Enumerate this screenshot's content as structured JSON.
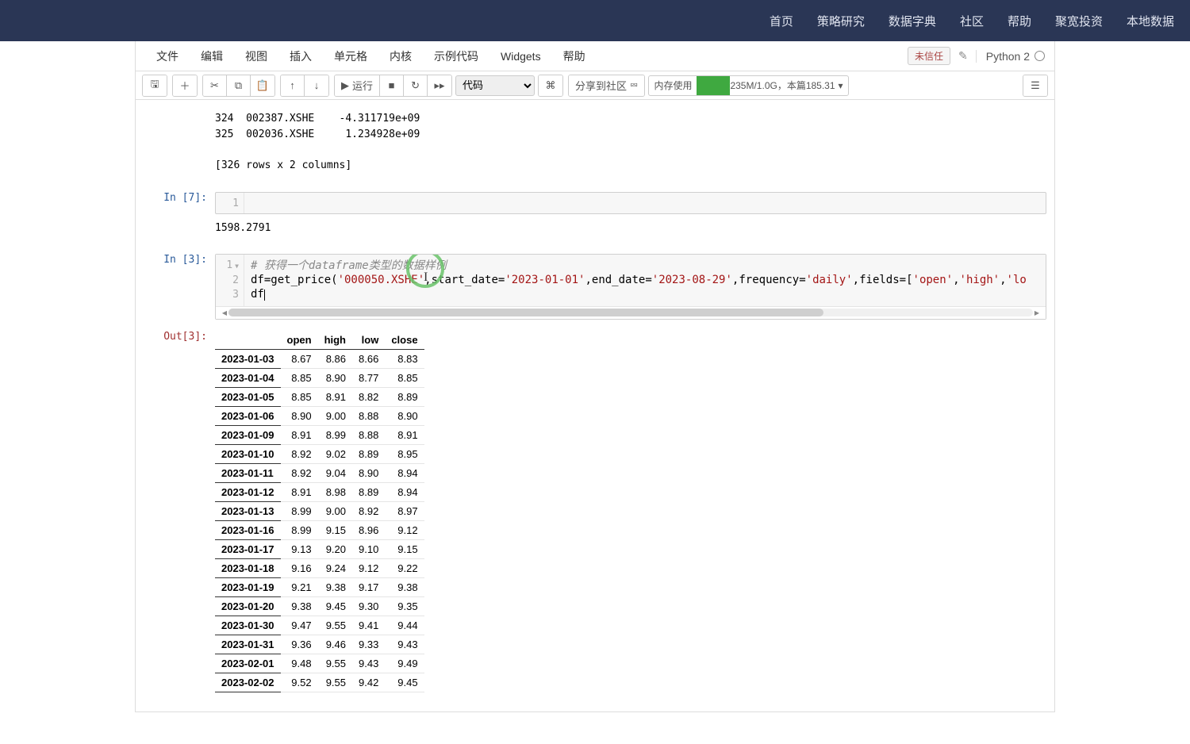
{
  "top_nav": {
    "items": [
      "首页",
      "策略研究",
      "数据字典",
      "社区",
      "帮助",
      "聚宽投资",
      "本地数据"
    ]
  },
  "menubar": {
    "items": [
      "文件",
      "编辑",
      "视图",
      "插入",
      "单元格",
      "内核",
      "示例代码",
      "Widgets",
      "帮助"
    ],
    "trust_badge": "未信任",
    "kernel": "Python 2"
  },
  "toolbar": {
    "run_label": "运行",
    "cell_type": "代码",
    "share_label": "分享到社区",
    "memory": {
      "label": "内存使用",
      "text": "235M/1.0G，本篇185.31"
    }
  },
  "cells": [
    {
      "type": "output",
      "text": "324  002387.XSHE    -4.311719e+09\n325  002036.XSHE     1.234928e+09\n\n[326 rows x 2 columns]"
    },
    {
      "type": "code",
      "prompt": "In  [7]:",
      "gutter": "1"
    },
    {
      "type": "output",
      "text": "1598.2791"
    },
    {
      "type": "code_main",
      "prompt": "In  [3]:",
      "gutters": [
        "1",
        "2",
        "3"
      ],
      "line1_comment": "# 获得一个dataframe类型的数据样例",
      "line2_a": "df=get_price(",
      "line2_s1": "'000050.XSHE'",
      "line2_b": ",start_date=",
      "line2_s2": "'2023-01-01'",
      "line2_c": ",end_date=",
      "line2_s3": "'2023-08-29'",
      "line2_d": ",frequency=",
      "line2_s4": "'daily'",
      "line2_e": ",fields=[",
      "line2_s5": "'open'",
      "line2_f": ",",
      "line2_s6": "'high'",
      "line2_g": ",",
      "line2_s7": "'lo",
      "line3": "df"
    },
    {
      "type": "df_output",
      "prompt": "Out[3]:",
      "columns": [
        "",
        "open",
        "high",
        "low",
        "close"
      ],
      "rows": [
        [
          "2023-01-03",
          "8.67",
          "8.86",
          "8.66",
          "8.83"
        ],
        [
          "2023-01-04",
          "8.85",
          "8.90",
          "8.77",
          "8.85"
        ],
        [
          "2023-01-05",
          "8.85",
          "8.91",
          "8.82",
          "8.89"
        ],
        [
          "2023-01-06",
          "8.90",
          "9.00",
          "8.88",
          "8.90"
        ],
        [
          "2023-01-09",
          "8.91",
          "8.99",
          "8.88",
          "8.91"
        ],
        [
          "2023-01-10",
          "8.92",
          "9.02",
          "8.89",
          "8.95"
        ],
        [
          "2023-01-11",
          "8.92",
          "9.04",
          "8.90",
          "8.94"
        ],
        [
          "2023-01-12",
          "8.91",
          "8.98",
          "8.89",
          "8.94"
        ],
        [
          "2023-01-13",
          "8.99",
          "9.00",
          "8.92",
          "8.97"
        ],
        [
          "2023-01-16",
          "8.99",
          "9.15",
          "8.96",
          "9.12"
        ],
        [
          "2023-01-17",
          "9.13",
          "9.20",
          "9.10",
          "9.15"
        ],
        [
          "2023-01-18",
          "9.16",
          "9.24",
          "9.12",
          "9.22"
        ],
        [
          "2023-01-19",
          "9.21",
          "9.38",
          "9.17",
          "9.38"
        ],
        [
          "2023-01-20",
          "9.38",
          "9.45",
          "9.30",
          "9.35"
        ],
        [
          "2023-01-30",
          "9.47",
          "9.55",
          "9.41",
          "9.44"
        ],
        [
          "2023-01-31",
          "9.36",
          "9.46",
          "9.33",
          "9.43"
        ],
        [
          "2023-02-01",
          "9.48",
          "9.55",
          "9.43",
          "9.49"
        ],
        [
          "2023-02-02",
          "9.52",
          "9.55",
          "9.42",
          "9.45"
        ]
      ]
    }
  ]
}
